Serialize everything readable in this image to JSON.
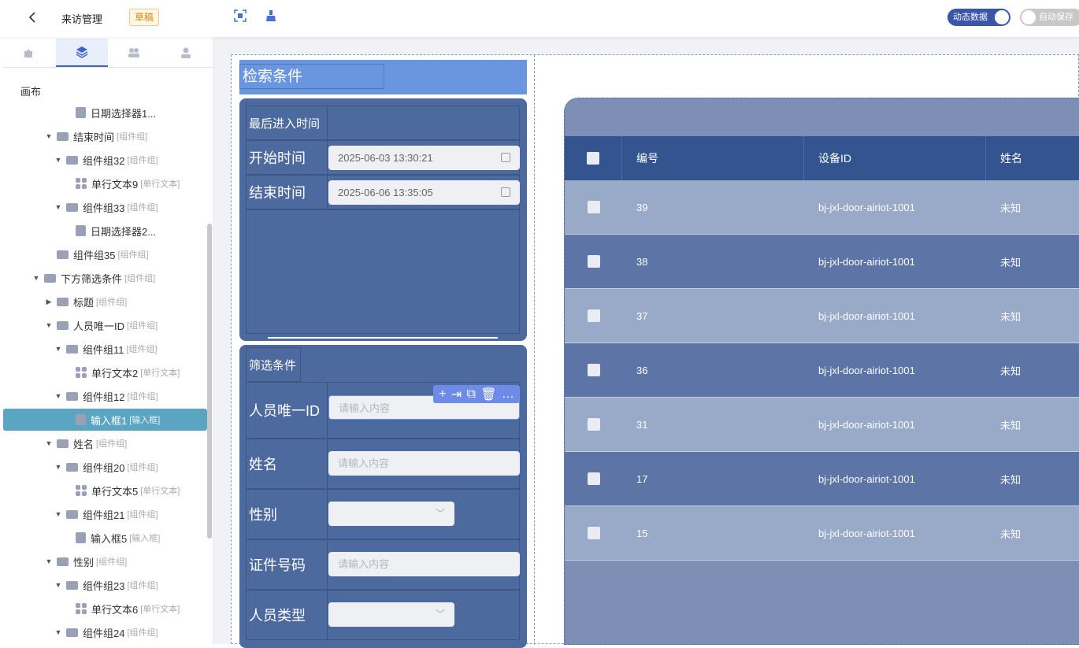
{
  "topbar": {
    "title": "来访管理",
    "badge": "草稿",
    "dynamic_label": "动态数据",
    "autosave_label": "自动保存"
  },
  "sidebar": {
    "canvas_label": "画布",
    "tree": [
      {
        "label": "日期选择器1...",
        "tag": "",
        "level": 3,
        "icon": "doc",
        "arrow": ""
      },
      {
        "label": "结束时间",
        "tag": "[组件组]",
        "level": 1,
        "icon": "folder",
        "arrow": "down"
      },
      {
        "label": "组件组32",
        "tag": "[组件组]",
        "level": 2,
        "icon": "folder",
        "arrow": "down"
      },
      {
        "label": "单行文本9",
        "tag": "[单行文本]",
        "level": 3,
        "icon": "grid",
        "arrow": ""
      },
      {
        "label": "组件组33",
        "tag": "[组件组]",
        "level": 2,
        "icon": "folder",
        "arrow": "down"
      },
      {
        "label": "日期选择器2...",
        "tag": "",
        "level": 3,
        "icon": "doc",
        "arrow": ""
      },
      {
        "label": "组件组35",
        "tag": "[组件组]",
        "level": 1,
        "icon": "folder",
        "arrow": ""
      },
      {
        "label": "下方筛选条件",
        "tag": "[组件组]",
        "level": 0,
        "icon": "folder",
        "arrow": "down"
      },
      {
        "label": "标题",
        "tag": "[组件组]",
        "level": 1,
        "icon": "folder",
        "arrow": "right"
      },
      {
        "label": "人员唯一ID",
        "tag": "[组件组]",
        "level": 1,
        "icon": "folder",
        "arrow": "down"
      },
      {
        "label": "组件组11",
        "tag": "[组件组]",
        "level": 2,
        "icon": "folder",
        "arrow": "down"
      },
      {
        "label": "单行文本2",
        "tag": "[单行文本]",
        "level": 3,
        "icon": "grid",
        "arrow": ""
      },
      {
        "label": "组件组12",
        "tag": "[组件组]",
        "level": 2,
        "icon": "folder",
        "arrow": "down"
      },
      {
        "label": "输入框1",
        "tag": "[输入框]",
        "level": 3,
        "icon": "doc",
        "arrow": "",
        "selected": true
      },
      {
        "label": "姓名",
        "tag": "[组件组]",
        "level": 1,
        "icon": "folder",
        "arrow": "down"
      },
      {
        "label": "组件组20",
        "tag": "[组件组]",
        "level": 2,
        "icon": "folder",
        "arrow": "down"
      },
      {
        "label": "单行文本5",
        "tag": "[单行文本]",
        "level": 3,
        "icon": "grid",
        "arrow": ""
      },
      {
        "label": "组件组21",
        "tag": "[组件组]",
        "level": 2,
        "icon": "folder",
        "arrow": "down"
      },
      {
        "label": "输入框5",
        "tag": "[输入框]",
        "level": 3,
        "icon": "doc",
        "arrow": ""
      },
      {
        "label": "性别",
        "tag": "[组件组]",
        "level": 1,
        "icon": "folder",
        "arrow": "down"
      },
      {
        "label": "组件组23",
        "tag": "[组件组]",
        "level": 2,
        "icon": "folder",
        "arrow": "down"
      },
      {
        "label": "单行文本6",
        "tag": "[单行文本]",
        "level": 3,
        "icon": "grid",
        "arrow": ""
      },
      {
        "label": "组件组24",
        "tag": "[组件组]",
        "level": 2,
        "icon": "folder",
        "arrow": "down"
      }
    ]
  },
  "search": {
    "header": "检索条件",
    "time_section": "最后进入时间",
    "start_label": "开始时间",
    "start_value": "2025-06-03 13:30:21",
    "end_label": "结束时间",
    "end_value": "2025-06-06 13:35:05",
    "filter_section": "筛选条件",
    "person_id_label": "人员唯一ID",
    "name_label": "姓名",
    "gender_label": "性别",
    "id_number_label": "证件号码",
    "person_type_label": "人员类型",
    "placeholder": "请输入内容"
  },
  "table": {
    "headers": [
      "编号",
      "设备ID",
      "姓名"
    ],
    "rows": [
      {
        "id": "39",
        "device": "bj-jxl-door-airiot-1001",
        "name": "未知"
      },
      {
        "id": "38",
        "device": "bj-jxl-door-airiot-1001",
        "name": "未知"
      },
      {
        "id": "37",
        "device": "bj-jxl-door-airiot-1001",
        "name": "未知"
      },
      {
        "id": "36",
        "device": "bj-jxl-door-airiot-1001",
        "name": "未知"
      },
      {
        "id": "31",
        "device": "bj-jxl-door-airiot-1001",
        "name": "未知"
      },
      {
        "id": "17",
        "device": "bj-jxl-door-airiot-1001",
        "name": "未知"
      },
      {
        "id": "15",
        "device": "bj-jxl-door-airiot-1001",
        "name": "未知"
      }
    ]
  }
}
